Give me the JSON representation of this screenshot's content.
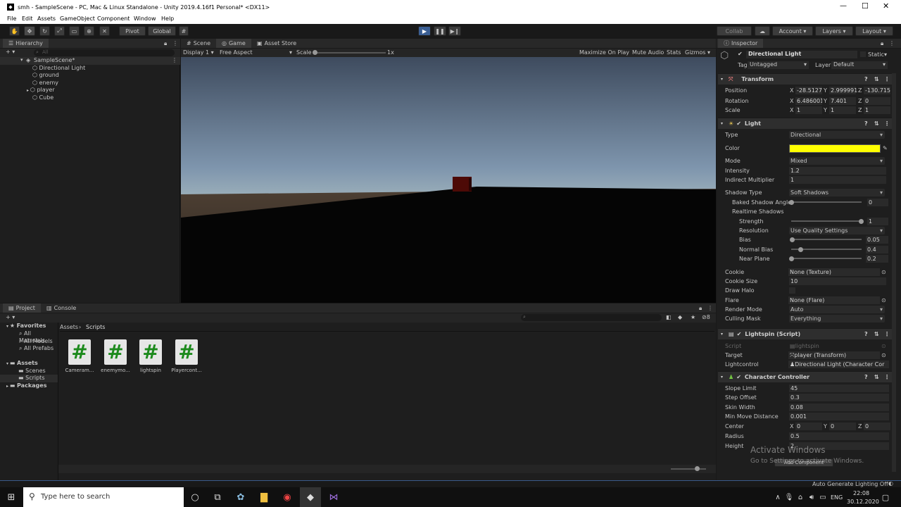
{
  "window": {
    "title": "smh - SampleScene - PC, Mac & Linux Standalone - Unity 2019.4.16f1 Personal* <DX11>"
  },
  "menu": [
    "File",
    "Edit",
    "Assets",
    "GameObject",
    "Component",
    "Window",
    "Help"
  ],
  "toolbar": {
    "pivot": "Pivot",
    "global": "Global",
    "collab": "Collab",
    "account": "Account",
    "layers": "Layers",
    "layout": "Layout"
  },
  "hierarchy": {
    "tab": "Hierarchy",
    "search_placeholder": "All",
    "scene": "SampleScene*",
    "items": [
      "Directional Light",
      "ground",
      "enemy",
      "player",
      "Cube"
    ]
  },
  "scene_tabs": {
    "scene": "Scene",
    "game": "Game",
    "store": "Asset Store"
  },
  "game_bar": {
    "display": "Display 1",
    "aspect": "Free Aspect",
    "scale_label": "Scale",
    "scale_value": "1x",
    "maximize": "Maximize On Play",
    "mute": "Mute Audio",
    "stats": "Stats",
    "gizmos": "Gizmos"
  },
  "project": {
    "tabs": [
      "Project",
      "Console"
    ],
    "favorites": "Favorites",
    "fav_items": [
      "All Materials",
      "All Models",
      "All Prefabs"
    ],
    "assets": "Assets",
    "asset_folders": [
      "Scenes",
      "Scripts"
    ],
    "packages": "Packages",
    "breadcrumb": [
      "Assets",
      "Scripts"
    ],
    "files": [
      "Cameram...",
      "enemymo...",
      "lightspin",
      "Playercont..."
    ],
    "count": "8"
  },
  "inspector": {
    "tab": "Inspector",
    "object_name": "Directional Light",
    "static_label": "Static",
    "tag_label": "Tag",
    "tag_value": "Untagged",
    "layer_label": "Layer",
    "layer_value": "Default",
    "transform": {
      "title": "Transform",
      "position": {
        "label": "Position",
        "x": "-28.5127",
        "y": "2.999991",
        "z": "-130.715"
      },
      "rotation": {
        "label": "Rotation",
        "x": "6.486001",
        "y": "7.401",
        "z": "0"
      },
      "scale": {
        "label": "Scale",
        "x": "1",
        "y": "1",
        "z": "1"
      }
    },
    "light": {
      "title": "Light",
      "type_label": "Type",
      "type_value": "Directional",
      "color_label": "Color",
      "color_hex": "#ffff00",
      "mode_label": "Mode",
      "mode_value": "Mixed",
      "intensity_label": "Intensity",
      "intensity_value": "1.2",
      "indirect_label": "Indirect Multiplier",
      "indirect_value": "1",
      "shadow_type_label": "Shadow Type",
      "shadow_type_value": "Soft Shadows",
      "baked_angle_label": "Baked Shadow Angle",
      "baked_angle_value": "0",
      "realtime_label": "Realtime Shadows",
      "strength_label": "Strength",
      "strength_value": "1",
      "resolution_label": "Resolution",
      "resolution_value": "Use Quality Settings",
      "bias_label": "Bias",
      "bias_value": "0.05",
      "normal_bias_label": "Normal Bias",
      "normal_bias_value": "0.4",
      "near_plane_label": "Near Plane",
      "near_plane_value": "0.2",
      "cookie_label": "Cookie",
      "cookie_value": "None (Texture)",
      "cookie_size_label": "Cookie Size",
      "cookie_size_value": "10",
      "draw_halo_label": "Draw Halo",
      "flare_label": "Flare",
      "flare_value": "None (Flare)",
      "render_mode_label": "Render Mode",
      "render_mode_value": "Auto",
      "culling_label": "Culling Mask",
      "culling_value": "Everything"
    },
    "lightspin": {
      "title": "Lightspin (Script)",
      "script_label": "Script",
      "script_value": "lightspin",
      "target_label": "Target",
      "target_value": "player (Transform)",
      "lightcontrol_label": "Lightcontrol",
      "lightcontrol_value": "Directional Light (Character Cor"
    },
    "cc": {
      "title": "Character Controller",
      "slope_label": "Slope Limit",
      "slope_value": "45",
      "step_label": "Step Offset",
      "step_value": "0.3",
      "skin_label": "Skin Width",
      "skin_value": "0.08",
      "minmove_label": "Min Move Distance",
      "minmove_value": "0.001",
      "center_label": "Center",
      "center_x": "0",
      "center_y": "0",
      "center_z": "0",
      "radius_label": "Radius",
      "radius_value": "0.5",
      "height_label": "Height",
      "height_value": "2"
    },
    "add_component": "Add Component"
  },
  "watermark": {
    "line1": "Activate Windows",
    "line2": "Go to Settings to activate Windows."
  },
  "status": {
    "right": "Auto Generate Lighting Off"
  },
  "taskbar": {
    "search": "Type here to search",
    "lang": "ENG",
    "time": "22:08",
    "date": "30.12.2020"
  }
}
